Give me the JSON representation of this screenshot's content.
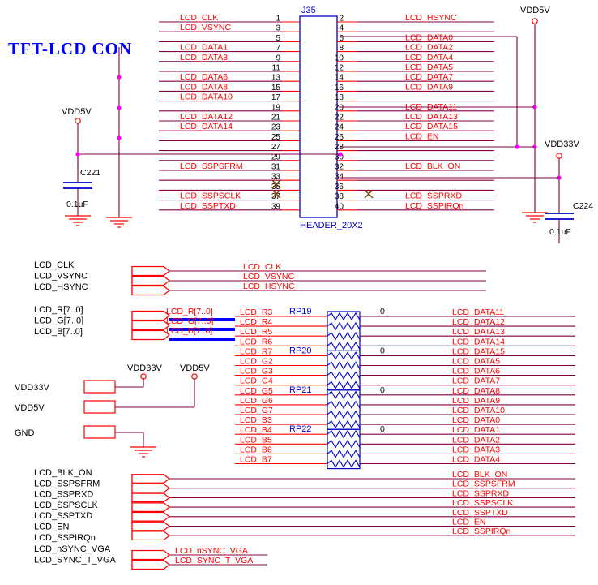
{
  "sheet": {
    "title": "TFT-LCD CON",
    "connector": {
      "refdes": "J35",
      "footprint": "HEADER_20X2",
      "odd_pins": [
        "1",
        "3",
        "5",
        "7",
        "9",
        "11",
        "13",
        "15",
        "17",
        "19",
        "21",
        "23",
        "25",
        "27",
        "29",
        "31",
        "33",
        "35",
        "37",
        "39"
      ],
      "even_pins": [
        "2",
        "4",
        "6",
        "8",
        "10",
        "12",
        "14",
        "16",
        "18",
        "20",
        "22",
        "24",
        "26",
        "28",
        "30",
        "32",
        "34",
        "36",
        "38",
        "40"
      ],
      "odd_nets": [
        "LCD_CLK",
        "LCD_VSYNC",
        "",
        "LCD_DATA1",
        "LCD_DATA3",
        "",
        "LCD_DATA6",
        "LCD_DATA8",
        "LCD_DATA10",
        "",
        "LCD_DATA12",
        "LCD_DATA14",
        "",
        "",
        "",
        "LCD_SSPSFRM",
        "",
        "",
        "LCD_SSPSCLK",
        "LCD_SSPTXD"
      ],
      "even_nets": [
        "LCD_HSYNC",
        "",
        "LCD_DATA0",
        "LCD_DATA2",
        "LCD_DATA4",
        "LCD_DATA5",
        "LCD_DATA7",
        "LCD_DATA9",
        "",
        "LCD_DATA11",
        "LCD_DATA13",
        "LCD_DATA15",
        "LCD_EN",
        "",
        "",
        "LCD_BLK_ON",
        "",
        "",
        "LCD_SSPRXD",
        "LCD_SSPIRQn"
      ]
    },
    "power_symbols": [
      {
        "name": "VDD5V",
        "id": "vdd5v-left"
      },
      {
        "name": "VDD5V",
        "id": "vdd5v-right"
      },
      {
        "name": "VDD33V",
        "id": "vdd33v-right"
      },
      {
        "name": "VDD33V",
        "id": "vdd33v-mid"
      },
      {
        "name": "VDD5V",
        "id": "vdd5v-mid"
      }
    ],
    "capacitors": [
      {
        "refdes": "C221",
        "value": "0.1uF"
      },
      {
        "refdes": "C224",
        "value": "0.1uF"
      }
    ]
  },
  "bus_groups": {
    "sync": {
      "ports": [
        "LCD_CLK",
        "LCD_VSYNC",
        "LCD_HSYNC"
      ],
      "nets": [
        "LCD_CLK",
        "LCD_VSYNC",
        "LCD_HSYNC"
      ]
    },
    "rgb": {
      "ports": [
        "LCD_R[7..0]",
        "LCD_G[7..0]",
        "LCD_B[7..0]"
      ],
      "bus_labels": [
        "LCD_R[7..0]",
        "LCD_G[7..0]",
        "LCD_B[7..0]"
      ]
    },
    "power": {
      "ports": [
        "VDD33V",
        "VDD5V",
        "GND"
      ]
    },
    "control": {
      "ports": [
        "LCD_BLK_ON",
        "LCD_SSPSFRM",
        "LCD_SSPRXD",
        "LCD_SSPSCLK",
        "LCD_SSPTXD",
        "LCD_EN",
        "LCD_SSPIRQn"
      ],
      "nets": [
        "LCD_BLK_ON",
        "LCD_SSPSFRM",
        "LCD_SSPRXD",
        "LCD_SSPSCLK",
        "LCD_SSPTXD",
        "LCD_EN",
        "LCD_SSPIRQn"
      ]
    },
    "vga": {
      "ports": [
        "LCD_nSYNC_VGA",
        "LCD_SYNC_T_VGA"
      ],
      "nets": [
        "LCD_nSYNC_VGA",
        "LCD_SYNC_T_VGA"
      ]
    }
  },
  "resistor_network": {
    "packs": [
      {
        "refdes": "RP19",
        "value": "0"
      },
      {
        "refdes": "RP20",
        "value": "0"
      },
      {
        "refdes": "RP21",
        "value": "0"
      },
      {
        "refdes": "RP22",
        "value": "0"
      }
    ],
    "rows": [
      {
        "left": "LCD_R3",
        "right": "LCD_DATA11"
      },
      {
        "left": "LCD_R4",
        "right": "LCD_DATA12"
      },
      {
        "left": "LCD_R5",
        "right": "LCD_DATA13"
      },
      {
        "left": "LCD_R6",
        "right": "LCD_DATA14"
      },
      {
        "left": "LCD_R7",
        "right": "LCD_DATA15"
      },
      {
        "left": "LCD_G2",
        "right": "LCD_DATA5"
      },
      {
        "left": "LCD_G3",
        "right": "LCD_DATA6"
      },
      {
        "left": "LCD_G4",
        "right": "LCD_DATA7"
      },
      {
        "left": "LCD_G5",
        "right": "LCD_DATA8"
      },
      {
        "left": "LCD_G6",
        "right": "LCD_DATA9"
      },
      {
        "left": "LCD_G7",
        "right": "LCD_DATA10"
      },
      {
        "left": "LCD_B3",
        "right": "LCD_DATA0"
      },
      {
        "left": "LCD_B4",
        "right": "LCD_DATA1"
      },
      {
        "left": "LCD_B5",
        "right": "LCD_DATA2"
      },
      {
        "left": "LCD_B6",
        "right": "LCD_DATA3"
      },
      {
        "left": "LCD_B7",
        "right": "LCD_DATA4"
      }
    ]
  },
  "colors": {
    "net": "#ff0000",
    "wire": "#800040",
    "outline": "#0000cc",
    "title": "#0000ff",
    "junction": "#ff00ff",
    "bus": "#0000ff",
    "nc_mark": "#804000"
  }
}
